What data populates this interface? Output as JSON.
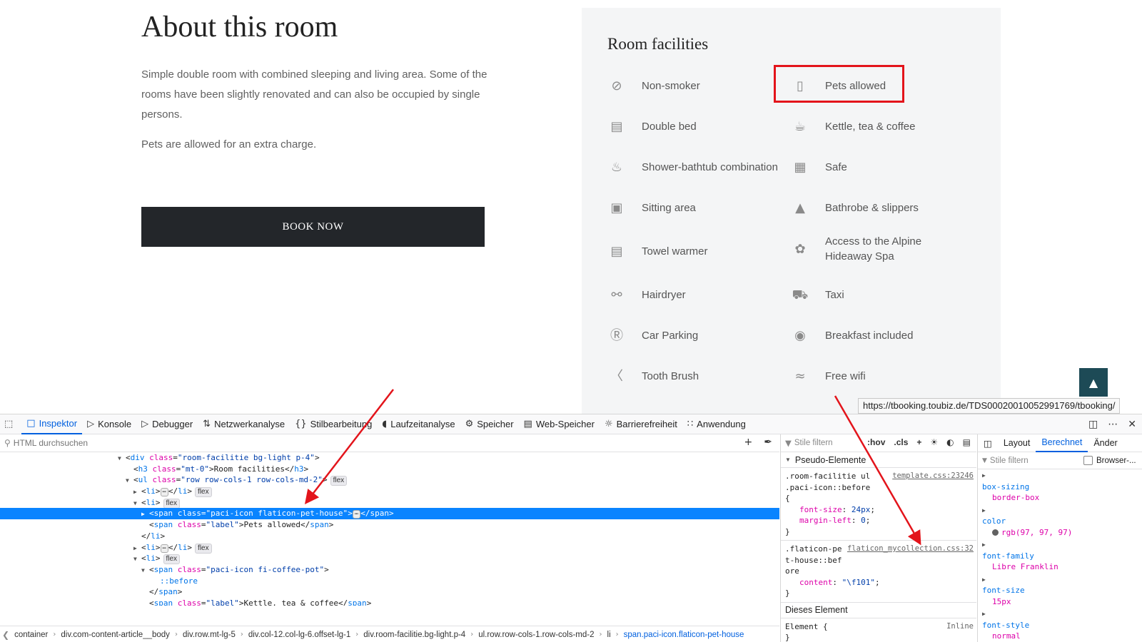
{
  "about": {
    "title": "About this room",
    "paragraph1": "Simple double room with combined sleeping and living area. Some of the rooms have been slightly renovated and can also be occupied by single persons.",
    "paragraph2": "Pets are allowed for an extra charge.",
    "book_button": "BOOK NOW"
  },
  "facilities": {
    "title": "Room facilities",
    "items": [
      {
        "label": "Non-smoker",
        "icon": "no-smoking-icon"
      },
      {
        "label": "Pets allowed",
        "icon": "pet-house-icon"
      },
      {
        "label": "Double bed",
        "icon": "bed-icon"
      },
      {
        "label": "Kettle, tea & coffee",
        "icon": "coffee-pot-icon"
      },
      {
        "label": "Shower-bathtub combination",
        "icon": "shower-icon"
      },
      {
        "label": "Safe",
        "icon": "safe-icon"
      },
      {
        "label": "Sitting area",
        "icon": "sofa-icon"
      },
      {
        "label": "Bathrobe & slippers",
        "icon": "bathrobe-icon"
      },
      {
        "label": "Towel warmer",
        "icon": "towel-warmer-icon"
      },
      {
        "label": "Access to the Alpine Hideaway Spa",
        "icon": "spa-icon"
      },
      {
        "label": "Hairdryer",
        "icon": "hairdryer-icon"
      },
      {
        "label": "Taxi",
        "icon": "taxi-icon"
      },
      {
        "label": "Car Parking",
        "icon": "parking-icon"
      },
      {
        "label": "Breakfast included",
        "icon": "breakfast-icon"
      },
      {
        "label": "Tooth Brush",
        "icon": "toothbrush-icon"
      },
      {
        "label": "Free wifi",
        "icon": "wifi-icon"
      }
    ]
  },
  "status_url": "https://tbooking.toubiz.de/TDS00020010052991769/tbooking/",
  "devtools": {
    "tabs": [
      "Inspektor",
      "Konsole",
      "Debugger",
      "Netzwerkanalyse",
      "Stilbearbeitung",
      "Laufzeitanalyse",
      "Speicher",
      "Web-Speicher",
      "Barrierefreiheit",
      "Anwendung"
    ],
    "search_placeholder": "HTML durchsuchen",
    "markup": {
      "l1_tag": "div",
      "l1_attr": "class",
      "l1_val": "\"room-facilitie bg-light p-4\"",
      "l2_tag": "h3",
      "l2_attr": "class",
      "l2_val": "\"mt-0\"",
      "l2_text": "Room facilities",
      "l3_tag": "ul",
      "l3_attr": "class",
      "l3_val": "\"row row-cols-1 row-cols-md-2\"",
      "li": "li",
      "span": "span",
      "sel_attr": "class",
      "sel_val": "\"paci-icon flaticon-pet-house\"",
      "label_attr": "class",
      "label_val": "\"label\"",
      "label_text": "Pets allowed",
      "coffee_val": "\"paci-icon fi-coffee-pot\"",
      "before": "::before",
      "label2_text": "Kettle, tea & coffee",
      "flex": "flex",
      "dots": "⋯"
    },
    "rules": {
      "filter_placeholder": "Stile filtern",
      "hov": ":hov",
      "cls": ".cls",
      "pseudo_title": "Pseudo-Elemente",
      "rule1_selector": ".room-facilitie ul .paci-icon::before",
      "rule1_source": "template.css:23246",
      "rule1_prop1": "font-size",
      "rule1_val1": "24px",
      "rule1_prop2": "margin-left",
      "rule1_val2": "0",
      "rule2_selector": ".flaticon-pet-house::before",
      "rule2_source": "flaticon_mycollection.css:32",
      "rule2_prop": "content",
      "rule2_val": "\"\\f101\"",
      "element_title": "Dieses Element",
      "element_selector": "Element",
      "inline": "Inline"
    },
    "computed": {
      "tabs": [
        "Layout",
        "Berechnet",
        "Änder"
      ],
      "filter_placeholder": "Stile filtern",
      "browser_label": "Browser-...",
      "props": [
        {
          "name": "box-sizing",
          "value": "border-box"
        },
        {
          "name": "color",
          "value": "rgb(97, 97, 97)"
        },
        {
          "name": "font-family",
          "value": "Libre Franklin"
        },
        {
          "name": "font-size",
          "value": "15px"
        },
        {
          "name": "font-style",
          "value": "normal"
        }
      ]
    },
    "breadcrumbs": [
      "container",
      "div.com-content-article__body",
      "div.row.mt-lg-5",
      "div.col-12.col-lg-6.offset-lg-1",
      "div.room-facilitie.bg-light.p-4",
      "ul.row.row-cols-1.row-cols-md-2",
      "li",
      "span.paci-icon.flaticon-pet-house"
    ]
  },
  "colors": {
    "accent": "#0060df",
    "highlight": "#e3141b",
    "button": "#23262a",
    "scroll_top": "#1d4a56"
  }
}
